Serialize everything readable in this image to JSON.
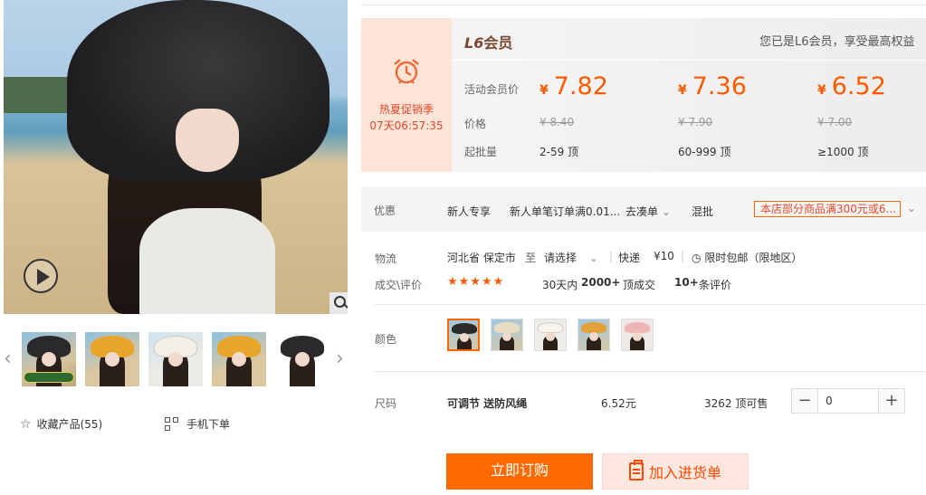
{
  "gallery": {
    "favorite_label": "收藏产品(55)",
    "mobile_label": "手机下单"
  },
  "promo": {
    "title": "热夏促销季",
    "timer": "07天06:57:35"
  },
  "member": {
    "level": "L6",
    "suffix": "会员",
    "note": "您已是L6会员，享受最高权益"
  },
  "price_table": {
    "label_member_price": "活动会员价",
    "label_price": "价格",
    "label_moq": "起批量",
    "currency": "¥",
    "tiers": [
      {
        "member_price": "7.82",
        "price": "¥ 8.40",
        "range": "2-59 顶"
      },
      {
        "member_price": "7.36",
        "price": "¥ 7.90",
        "range": "60-999 顶"
      },
      {
        "member_price": "6.52",
        "price": "¥ 7.00",
        "range": "≥1000 顶"
      }
    ]
  },
  "offers": {
    "label": "优惠",
    "new_user": "新人专享",
    "new_user_desc": "新人单笔订单满0.01...",
    "go_bundle": "去凑单",
    "mixed": "混批",
    "coupon": "本店部分商品满300元或6..."
  },
  "logistics": {
    "label": "物流",
    "from": "河北省 保定市",
    "to_word": "至",
    "to_select": "请选择",
    "express": "快递",
    "fee": "¥10",
    "free_ship": "限时包邮（限地区）"
  },
  "deals": {
    "label": "成交\\评价",
    "stars": "★★★★★",
    "period": "30天内",
    "count": "2000+",
    "count_suffix": "顶成交",
    "reviews": "10+",
    "reviews_suffix": "条评价"
  },
  "color": {
    "label": "颜色",
    "options": [
      "black",
      "beige",
      "white",
      "khaki",
      "pink"
    ],
    "selected_index": 0
  },
  "size": {
    "label": "尺码",
    "name": "可调节 送防风绳",
    "price": "6.52元",
    "stock": "3262 顶可售",
    "quantity": "0"
  },
  "actions": {
    "buy": "立即订购",
    "add_to_list": "加入进货单"
  },
  "colors": {
    "accent": "#ff6a00",
    "promo_red": "#e4472b"
  }
}
